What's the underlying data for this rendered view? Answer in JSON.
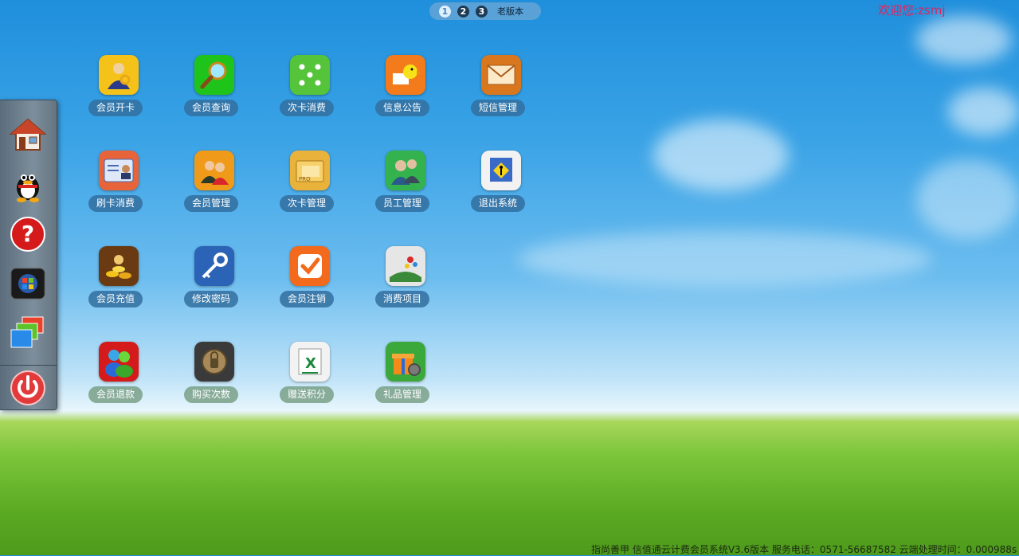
{
  "pager": {
    "pages": [
      "1",
      "2",
      "3"
    ],
    "active_page": "1",
    "old_version_label": "老版本"
  },
  "header": {
    "welcome_text": "欢迎您:zsmj"
  },
  "dock": {
    "items": [
      "home-icon",
      "qq-icon",
      "help-icon",
      "windows-icon",
      "windows-switch-icon"
    ],
    "power": "power-icon"
  },
  "apps": [
    {
      "label": "会员开卡",
      "icon": "member-key-icon",
      "color": "#f5c21a"
    },
    {
      "label": "会员查询",
      "icon": "magnifier-icon",
      "color": "#1fc41a"
    },
    {
      "label": "次卡消费",
      "icon": "dice-icon",
      "color": "#55c43a"
    },
    {
      "label": "信息公告",
      "icon": "bird-notice-icon",
      "color": "#f37b1c"
    },
    {
      "label": "短信管理",
      "icon": "envelope-icon",
      "color": "#d9771e"
    },
    {
      "label": "刷卡消费",
      "icon": "id-card-icon",
      "color": "#e7643a"
    },
    {
      "label": "会员管理",
      "icon": "people-icon",
      "color": "#f09a1a"
    },
    {
      "label": "次卡管理",
      "icon": "folder-pro-icon",
      "color": "#e9b23a"
    },
    {
      "label": "员工管理",
      "icon": "staff-icon",
      "color": "#33b24e"
    },
    {
      "label": "退出系统",
      "icon": "exit-sign-icon",
      "color": "#f2f2f2"
    },
    {
      "label": "会员充值",
      "icon": "coins-icon",
      "color": "#6a3a12"
    },
    {
      "label": "修改密码",
      "icon": "key-icon",
      "color": "#2b63b7"
    },
    {
      "label": "会员注销",
      "icon": "checkmark-icon",
      "color": "#f36a1c"
    },
    {
      "label": "消费项目",
      "icon": "gift-scene-icon",
      "color": "#e6e6e6"
    },
    {
      "label": "会员退款",
      "icon": "msn-people-icon",
      "color": "#d41a1a"
    },
    {
      "label": "购买次数",
      "icon": "lock-icon",
      "color": "#3a3a3a"
    },
    {
      "label": "赠送积分",
      "icon": "excel-icon",
      "color": "#f2f2f2"
    },
    {
      "label": "礼品管理",
      "icon": "gift-box-icon",
      "color": "#3aa83a"
    }
  ],
  "footer": {
    "text": "指尚善甲 信值通云计费会员系统V3.6版本 服务电话：0571-56687582 云端处理时间：0.000988s"
  }
}
